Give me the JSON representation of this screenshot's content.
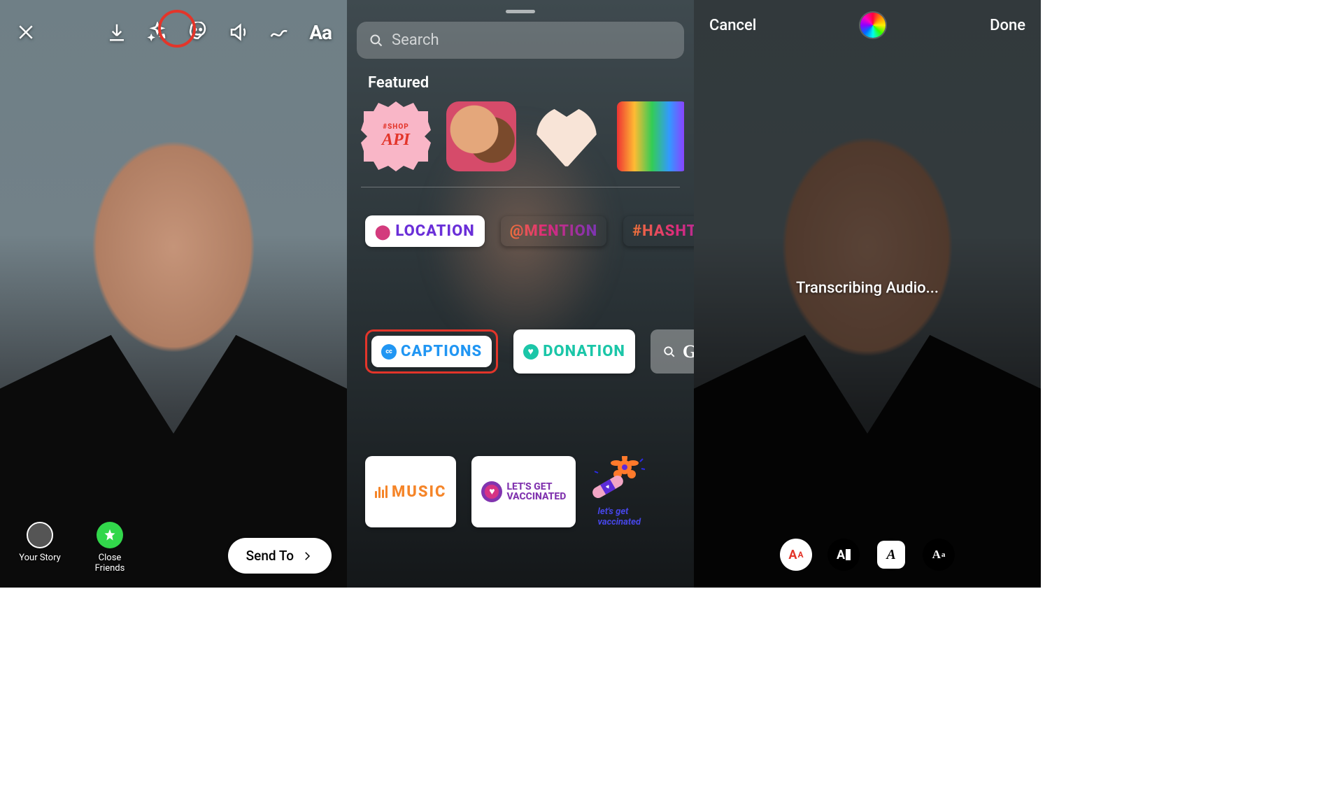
{
  "panel1": {
    "toolbar": {
      "close": "close",
      "download": "download",
      "effects": "sparkle effects",
      "sticker": "sticker",
      "audio": "audio",
      "draw": "draw",
      "text": "Aa"
    },
    "shareTargets": [
      {
        "label": "Your Story",
        "kind": "avatar"
      },
      {
        "label": "Close Friends",
        "kind": "star"
      }
    ],
    "sendTo": "Send To"
  },
  "panel2": {
    "search": {
      "placeholder": "Search"
    },
    "featuredLabel": "Featured",
    "featuredStickers": [
      {
        "id": "shop-api",
        "top": "#SHOP",
        "main": "API"
      },
      {
        "id": "family-hug"
      },
      {
        "id": "heart-family"
      },
      {
        "id": "rainbow-dance"
      }
    ],
    "chips": {
      "location": "LOCATION",
      "mention": "@MENTION",
      "hashtag": "#HASHTAG",
      "captionsCC": "cc",
      "captions": "CAPTIONS",
      "donation": "DONATION",
      "gif": "GI",
      "music": "MUSIC",
      "vaccinated1": "LET'S GET",
      "vaccinated2": "VACCINATED",
      "vaxFlower": "let's get\nvaccinated"
    }
  },
  "panel3": {
    "cancel": "Cancel",
    "done": "Done",
    "status": "Transcribing Audio...",
    "styleSelected": "AA",
    "styleDark": "A",
    "stylePlate": "A",
    "styleSerif": "Aa"
  }
}
